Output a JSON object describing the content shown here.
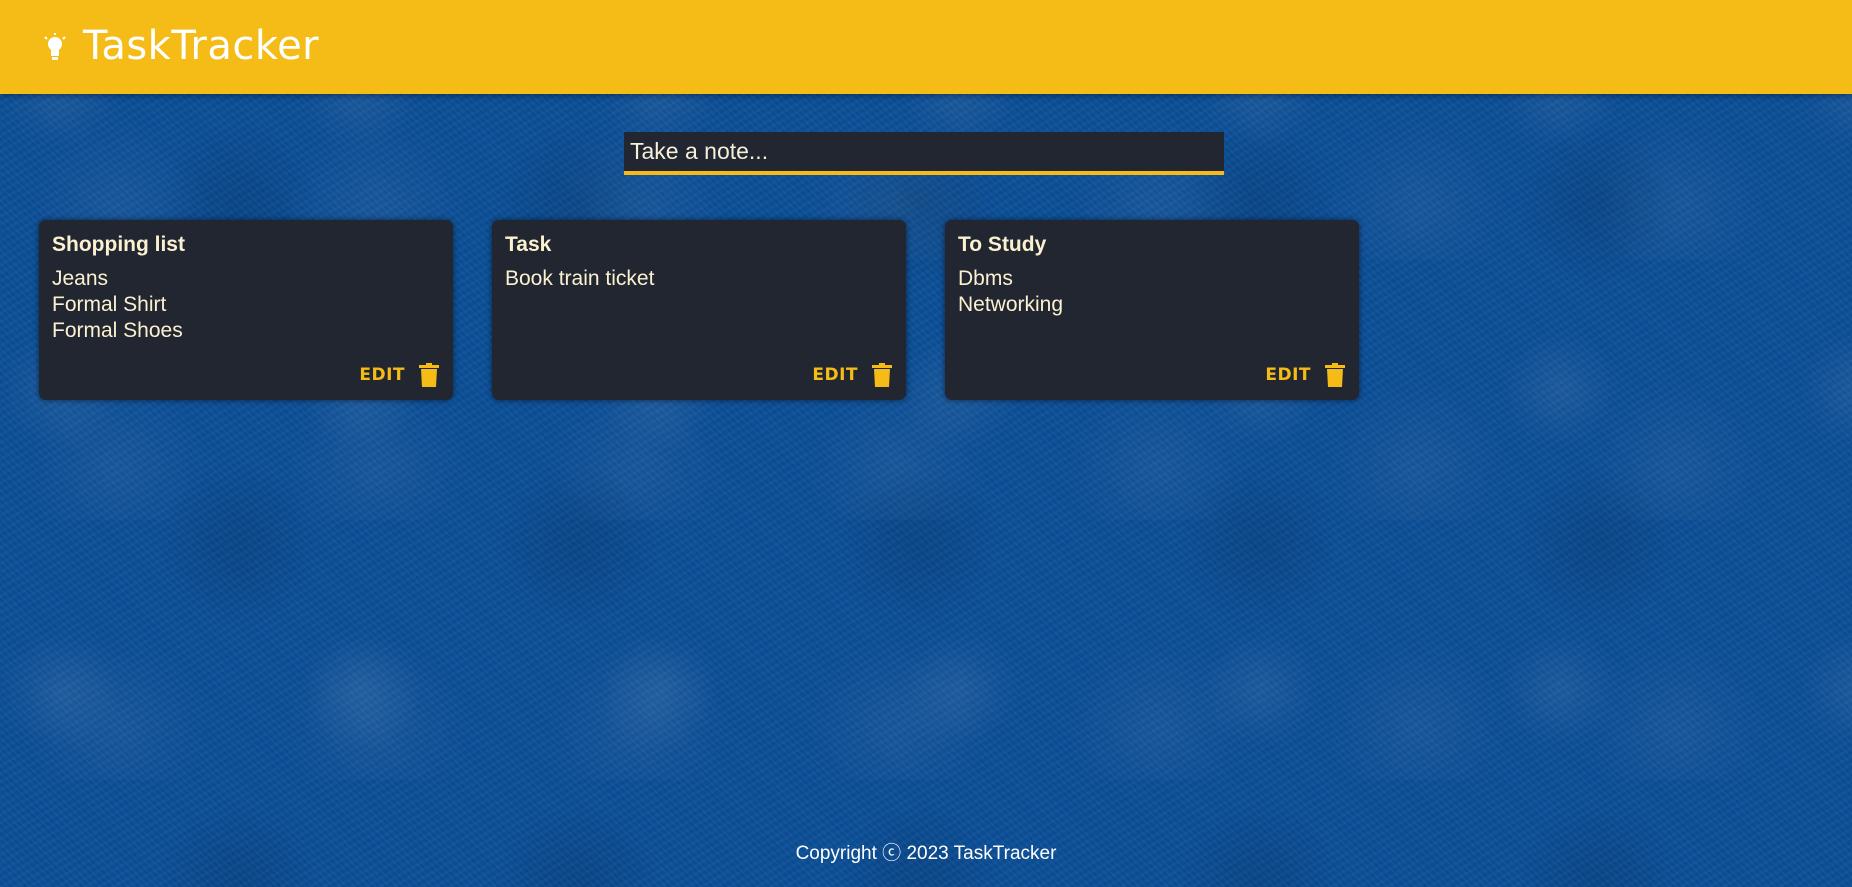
{
  "header": {
    "title": "TaskTracker",
    "logo_icon": "lightbulb-icon",
    "background_color": "#f5bb16"
  },
  "note_input": {
    "placeholder": "Take a note..."
  },
  "notes": [
    {
      "title": "Shopping list",
      "lines": [
        "Jeans",
        "Formal Shirt",
        "Formal Shoes"
      ],
      "edit_label": "EDIT",
      "delete_icon": "trash-icon"
    },
    {
      "title": "Task",
      "lines": [
        "Book train ticket"
      ],
      "edit_label": "EDIT",
      "delete_icon": "trash-icon"
    },
    {
      "title": "To Study",
      "lines": [
        "Dbms",
        "Networking"
      ],
      "edit_label": "EDIT",
      "delete_icon": "trash-icon"
    }
  ],
  "footer": {
    "text": "Copyright ⓒ 2023 TaskTracker"
  },
  "colors": {
    "accent": "#f5bb16",
    "card_background": "#212631",
    "card_text": "#fbf1d0",
    "page_background": "#0b4f98"
  }
}
